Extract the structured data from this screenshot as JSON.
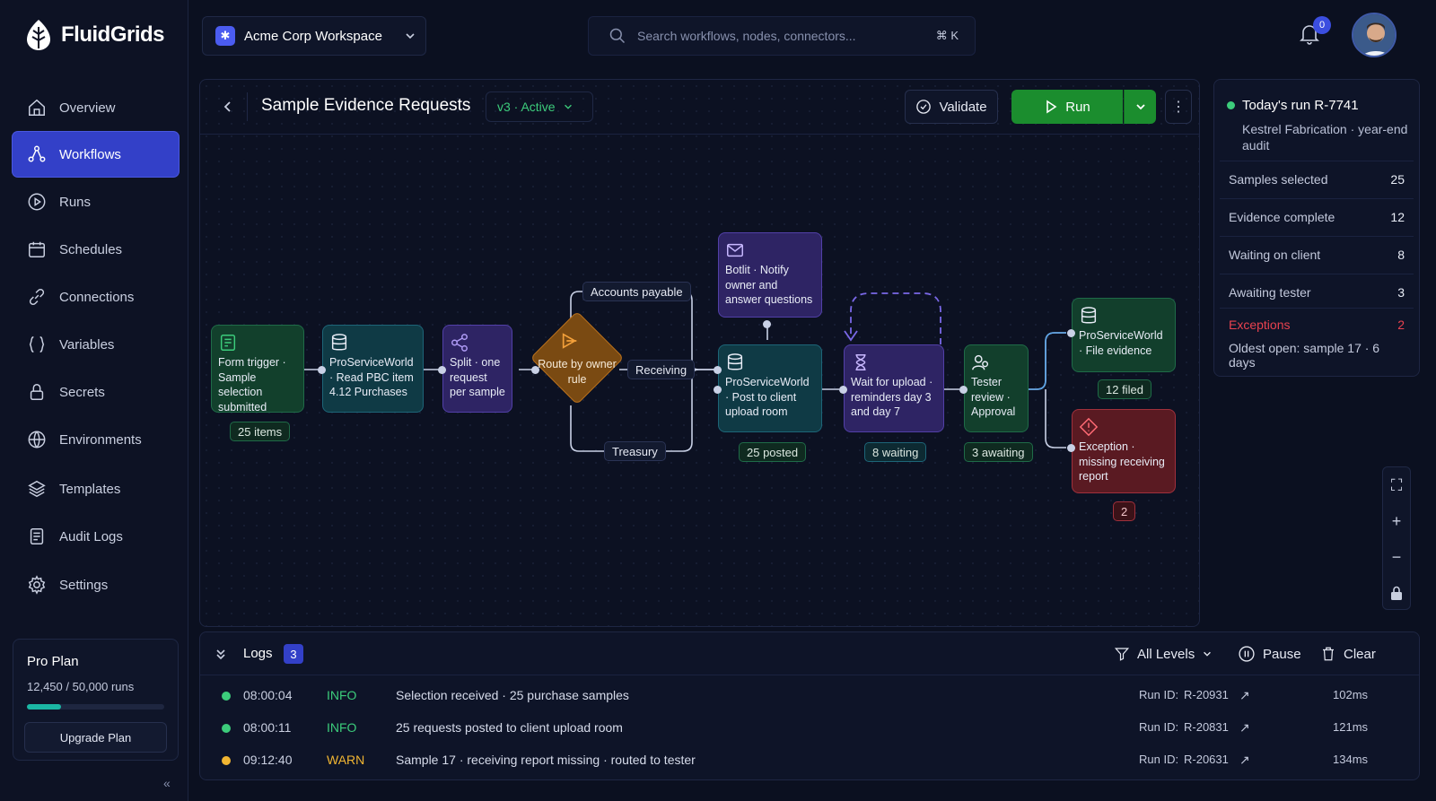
{
  "app": {
    "name": "FluidGrids"
  },
  "sidebar": {
    "items": [
      {
        "label": "Overview"
      },
      {
        "label": "Workflows"
      },
      {
        "label": "Runs"
      },
      {
        "label": "Schedules"
      },
      {
        "label": "Connections"
      },
      {
        "label": "Variables"
      },
      {
        "label": "Secrets"
      },
      {
        "label": "Environments"
      },
      {
        "label": "Templates"
      },
      {
        "label": "Audit Logs"
      },
      {
        "label": "Settings"
      }
    ],
    "active": "Workflows",
    "plan": {
      "title": "Pro Plan",
      "runs": "12,450 / 50,000 runs",
      "usage_fraction": 0.249,
      "upgrade_label": "Upgrade Plan"
    }
  },
  "topbar": {
    "workspace": "Acme Corp Workspace",
    "search_placeholder": "Search workflows, nodes, connectors...",
    "shortcut": "⌘ K",
    "notifications": "0"
  },
  "workflow": {
    "title": "Sample Evidence Requests",
    "version": "v3 · Active",
    "validate_label": "Validate",
    "run_label": "Run",
    "nodes": {
      "form_trigger": {
        "text": "Form trigger · Sample selection submitted",
        "chip": "25 items"
      },
      "read_pbc": {
        "text": "ProServiceWorld · Read PBC item 4.12 Purchases"
      },
      "split": {
        "text": "Split · one request per sample"
      },
      "route": {
        "text": "Route by owner rule"
      },
      "botlit": {
        "text": "Botlit · Notify owner and answer questions"
      },
      "post_upload": {
        "text": "ProServiceWorld · Post to client upload room",
        "chip": "25 posted"
      },
      "wait_upload": {
        "text": "Wait for upload · reminders day 3 and day 7",
        "chip": "8 waiting"
      },
      "tester_review": {
        "text": "Tester review · Approval",
        "chip": "3 awaiting"
      },
      "file_evidence": {
        "text": "ProServiceWorld · File evidence",
        "chip": "12 filed"
      },
      "exception": {
        "text": "Exception · missing receiving report",
        "chip": "2"
      }
    },
    "edge_labels": {
      "accounts_payable": "Accounts payable",
      "receiving": "Receiving",
      "treasury": "Treasury"
    }
  },
  "run_panel": {
    "title": "Today's run R-7741",
    "subtitle": "Kestrel Fabrication · year-end audit",
    "stats": [
      {
        "label": "Samples selected",
        "value": "25"
      },
      {
        "label": "Evidence complete",
        "value": "12"
      },
      {
        "label": "Waiting on client",
        "value": "8"
      },
      {
        "label": "Awaiting tester",
        "value": "3"
      }
    ],
    "exceptions": {
      "label": "Exceptions",
      "value": "2",
      "oldest": "Oldest open: sample 17 · 6 days"
    }
  },
  "logs": {
    "title": "Logs",
    "count": "3",
    "level_filter": "All Levels",
    "pause_label": "Pause",
    "clear_label": "Clear",
    "rows": [
      {
        "time": "08:00:04",
        "level": "INFO",
        "message": "Selection received · 25 purchase samples",
        "run_label": "Run ID:",
        "run_id": "R-20931",
        "duration": "102ms",
        "color": "#3ccc7b"
      },
      {
        "time": "08:00:11",
        "level": "INFO",
        "message": "25 requests posted to client upload room",
        "run_label": "Run ID:",
        "run_id": "R-20831",
        "duration": "121ms",
        "color": "#3ccc7b"
      },
      {
        "time": "09:12:40",
        "level": "WARN",
        "message": "Sample 17 · receiving report missing · routed to tester",
        "run_label": "Run ID:",
        "run_id": "R-20631",
        "duration": "134ms",
        "color": "#f2b632"
      }
    ]
  },
  "colors": {
    "accent": "#3340c8",
    "run": "#1b8d2e",
    "info": "#3ccc7b",
    "warn": "#f2b632",
    "error": "#e8424f"
  }
}
